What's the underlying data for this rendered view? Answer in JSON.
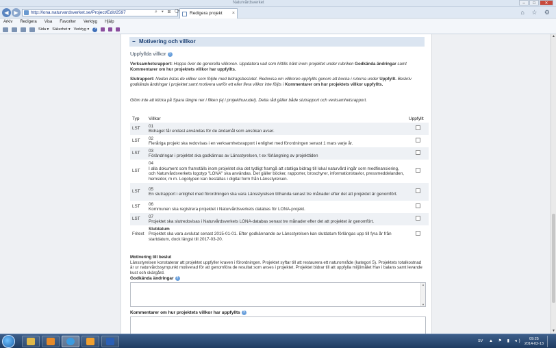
{
  "browser": {
    "window_title": "Naturvårdsverket",
    "url": "http://lona.naturvardsverket.se/Project/Edit/2597",
    "tab_title": "Redigera projekt",
    "tab_close": "×",
    "win_min": "–",
    "win_max": "□",
    "win_close": "✕",
    "nav_back": "◀",
    "nav_forward": "▶",
    "addr_tools": "⌕ ▾ ⊠ ⟳ ✕",
    "right_tools": "⌂ ☆ ⚙",
    "menu": [
      "Arkiv",
      "Redigera",
      "Visa",
      "Favoriter",
      "Verktyg",
      "Hjälp"
    ],
    "command_bar": {
      "sida": "Sida ▾",
      "sakerhet": "Säkerhet ▾",
      "verktyg": "Verktyg ▾",
      "help": "?"
    }
  },
  "section": {
    "toggle": "−",
    "title": "Motivering och villkor",
    "subtitle": "Uppfyllda villkor",
    "info_icon": "?"
  },
  "instructions": {
    "verksamhet_label": "Verksamhetsrapport:",
    "verksamhet_text": "Hoppa över de generella villkoren. Uppdatera vad som hittills hänt inom projektet under rubriken",
    "verksamhet_bold1": "Godkända ändringar",
    "verksamhet_mid": "samt",
    "verksamhet_bold2": "Kommentarer om hur projektets villkor har uppfyllts.",
    "slut_label": "Slutrapport:",
    "slut_text1": "Nedan listas de villkor som följde med bidragsbeslutet. Redovisa om villkoren uppfyllts genom att bocka i rutorna under",
    "slut_bold1": "Uppfyllt.",
    "slut_text2": "Beskriv godkända ändringar i projektet samt motivera varför ett eller flera villkor inte följts i",
    "slut_bold2": "Kommentarer om hur projektets villkor uppfyllts.",
    "reminder": "Glöm inte att klicka på Spara längre ner i fliken (ej i projekthuvudet). Detta råd gäller både slutrapport och verksamhetsrapport."
  },
  "table": {
    "headers": [
      "Typ",
      "Villkor",
      "Uppfyllt"
    ],
    "rows": [
      {
        "typ": "LST",
        "title": "01",
        "desc": "Bidraget får endast användas för de ändamål som ansökan avser."
      },
      {
        "typ": "LST",
        "title": "02",
        "desc": "Fleråriga projekt ska redovisas i en verksamhetsrapport i enlighet med förordningen senast 1 mars varje år."
      },
      {
        "typ": "LST",
        "title": "03",
        "desc": "Förändringar i projektet ska godkännas av Länsstyrelsen, t ex förlängning av projekttiden"
      },
      {
        "typ": "LST",
        "title": "04",
        "desc": "I alla dokument som framställs inom projektet ska det tydligt framgå att statliga bidrag till lokal naturvård ingår som medfinansiering, och Naturvårdsverkets logotyp \"LONA\" ska användas. Det gäller böcker, rapporter, broschyrer, informationstavlor, pressmeddelanden, hemsidor, m m. Logotypen kan beställas i digital form från Länsstyrelsen."
      },
      {
        "typ": "LST",
        "title": "05",
        "desc": "En slutrapport i enlighet med förordningen ska vara Länsstyrelsen tillhanda senast tre månader efter det att projektet är genomfört."
      },
      {
        "typ": "LST",
        "title": "06",
        "desc": "Kommunen ska registrera projektet i Naturvårdsverkets databas för LONA-projekt."
      },
      {
        "typ": "LST",
        "title": "07",
        "desc": "Projektet ska slutredovisas i Naturvårdsverkets LONA-databas senast tre månader efter det att projektet är genomfört."
      },
      {
        "typ": "Fritext",
        "title": "Slutdatum",
        "desc": "Projektet ska vara avslutat senast 2015-01-01. Efter godkännande av Länsstyrelsen kan slutdatum förlängas upp till fyra år från startdatum, dock längst till 2017-03-20."
      }
    ]
  },
  "motivering": {
    "label": "Motivering till beslut",
    "text": "Länsstyrelsen konstaterar att projektet uppfyller kraven i förordningen. Projektet syftar till att restaurera ett naturområde (kategori 5). Projektets totalkostnad är ur naturvårdssympunkt motiverad för att genomföra de resultat som avses i projektet. Projektet bidrar till att uppfylla miljömålet Hav i balans samt levande kust och skärgård."
  },
  "fields": {
    "godkanda_label": "Godkända ändringar",
    "godkanda_value": "",
    "kommentarer_label": "Kommentarer om hur projektets villkor har uppfyllts",
    "kommentarer_value": ""
  },
  "scroll": {
    "up": "▲",
    "down": "▼"
  },
  "taskbar": {
    "language": "SV",
    "tray_icons": "▲ ⚑ ▮ ◂)",
    "time": "09:25",
    "date": "2014-02-13",
    "apps": [
      {
        "name": "explorer",
        "color": "#e0b84a"
      },
      {
        "name": "media-player",
        "color": "#e58a2a"
      },
      {
        "name": "internet-explorer",
        "color": "#3b9be0"
      },
      {
        "name": "outlook",
        "color": "#f0a030"
      },
      {
        "name": "word",
        "color": "#2b5fb4"
      }
    ]
  }
}
